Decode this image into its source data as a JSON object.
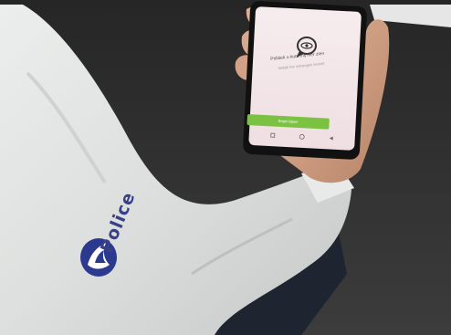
{
  "photo": {
    "screen": {
      "app_tagline": "Politiek u kunt mij hier zien",
      "app_subline": "Bekijk het ontvangen bericht",
      "button_label": "Begin kijken",
      "accent_color": "#7cc242",
      "icon": "chat-eye-icon"
    },
    "uniform": {
      "logo_text": "Police",
      "logo_icon": "police-flame-logo-icon",
      "brand_color": "#2b3a8f"
    }
  }
}
